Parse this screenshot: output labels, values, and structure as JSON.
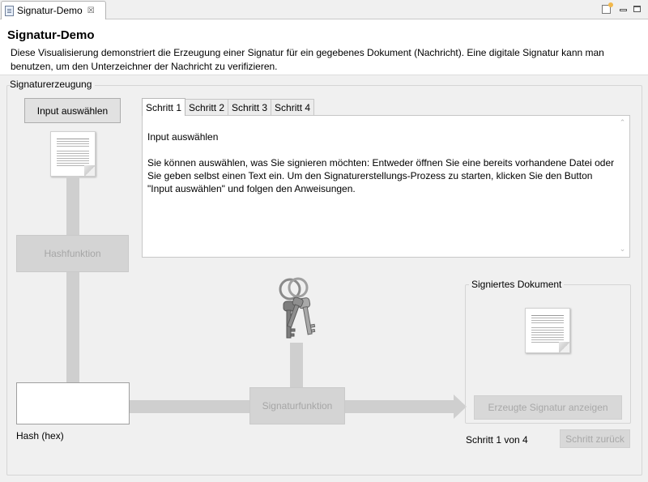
{
  "view": {
    "tab_title": "Signatur-Demo",
    "tab_close": "☒",
    "icons": [
      "document-icon",
      "new-view-icon",
      "minimize-icon",
      "maximize-icon"
    ]
  },
  "header": {
    "title": "Signatur-Demo",
    "description": "Diese Visualisierung demonstriert die Erzeugung einer Signatur für ein gegebenes Dokument (Nachricht). Eine digitale Signatur kann man benutzen, um den Unterzeichner der Nachricht zu verifizieren."
  },
  "group": {
    "title": "Signaturerzeugung"
  },
  "buttons": {
    "input": "Input auswählen",
    "show_signature": "Erzeugte Signatur anzeigen",
    "step_back": "Schritt zurück"
  },
  "flow": {
    "hash_function": "Hashfunktion",
    "signature_function": "Signaturfunktion",
    "hash_label": "Hash (hex)"
  },
  "tabs": [
    {
      "label": "Schritt 1",
      "active": true
    },
    {
      "label": "Schritt 2",
      "active": false
    },
    {
      "label": "Schritt 3",
      "active": false
    },
    {
      "label": "Schritt 4",
      "active": false
    }
  ],
  "step_text": {
    "heading": "Input auswählen",
    "body": "Sie können auswählen, was Sie signieren möchten: Entweder öffnen Sie eine bereits vorhandene Datei oder Sie geben selbst einen Text ein. Um den Signaturerstellungs-Prozess zu starten, klicken Sie den Button \"Input auswählen\" und folgen den Anweisungen."
  },
  "signed_document": {
    "title": "Signiertes Dokument"
  },
  "status": {
    "step_counter": "Schritt 1 von 4"
  },
  "colors": {
    "accent_disabled": "#a8a8a8",
    "connector": "#cfcfcf",
    "background": "#f0f0f0"
  }
}
